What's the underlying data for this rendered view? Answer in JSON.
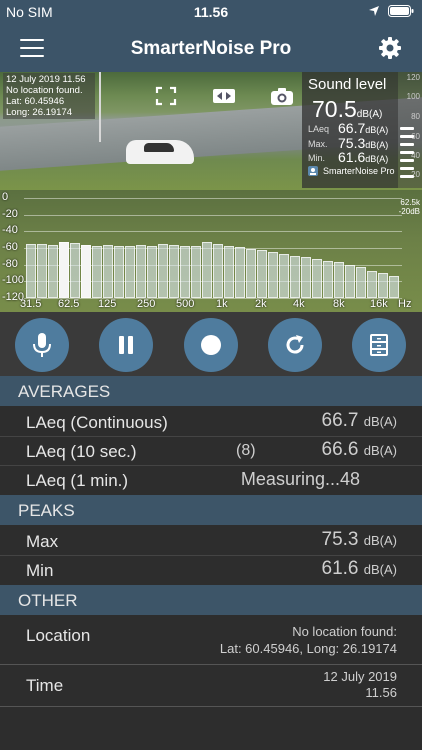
{
  "status": {
    "carrier": "No SIM",
    "time": "11.56"
  },
  "nav": {
    "title": "SmarterNoise Pro"
  },
  "camera": {
    "overlay_date": "12 July 2019 11.56",
    "overlay_location": "No location found.",
    "overlay_lat": "Lat: 60.45946",
    "overlay_long": "Long: 26.19174"
  },
  "sound_level": {
    "title": "Sound level",
    "value": "70.5",
    "unit": "dB(A)",
    "laeq_label": "LAeq",
    "laeq_value": "66.7",
    "max_label": "Max.",
    "max_value": "75.3",
    "min_label": "Min.",
    "min_value": "61.6",
    "row_unit": "dB(A)",
    "brand": "SmarterNoise Pro"
  },
  "scale_labels": [
    "120",
    "100",
    "80",
    "60",
    "40",
    "20"
  ],
  "spectrum": {
    "y_labels": [
      "0",
      "-20",
      "-40",
      "-60",
      "-80",
      "-100",
      "-120"
    ],
    "x_labels": [
      "31.5",
      "62.5",
      "125",
      "250",
      "500",
      "1k",
      "2k",
      "4k",
      "8k",
      "16k",
      "Hz"
    ],
    "top_right_1": "62.5k",
    "top_right_2": "-20dB",
    "levels": [
      -55,
      -55,
      -56,
      -53,
      -54,
      -56,
      -57,
      -56,
      -57,
      -57,
      -56,
      -57,
      -55,
      -56,
      -57,
      -57,
      -53,
      -55,
      -58,
      -59,
      -61,
      -62,
      -65,
      -67,
      -69,
      -71,
      -73,
      -75,
      -77,
      -80,
      -83,
      -87,
      -90,
      -93
    ],
    "highlighted": [
      3,
      5
    ]
  },
  "sections": {
    "averages": "AVERAGES",
    "peaks": "PEAKS",
    "other": "OTHER"
  },
  "averages": {
    "continuous_label": "LAeq (Continuous)",
    "continuous_value": "66.7",
    "continuous_unit": "dB(A)",
    "tensec_label": "LAeq (10 sec.)",
    "tensec_count": "(8)",
    "tensec_value": "66.6",
    "tensec_unit": "dB(A)",
    "onemin_label": "LAeq (1 min.)",
    "onemin_value": "Measuring...48"
  },
  "peaks": {
    "max_label": "Max",
    "max_value": "75.3",
    "max_unit": "dB(A)",
    "min_label": "Min",
    "min_value": "61.6",
    "min_unit": "dB(A)"
  },
  "other": {
    "location_label": "Location",
    "location_line1": "No location found:",
    "location_line2": "Lat: 60.45946, Long: 26.19174",
    "time_label": "Time",
    "time_line1": "12 July 2019",
    "time_line2": "11.56"
  }
}
